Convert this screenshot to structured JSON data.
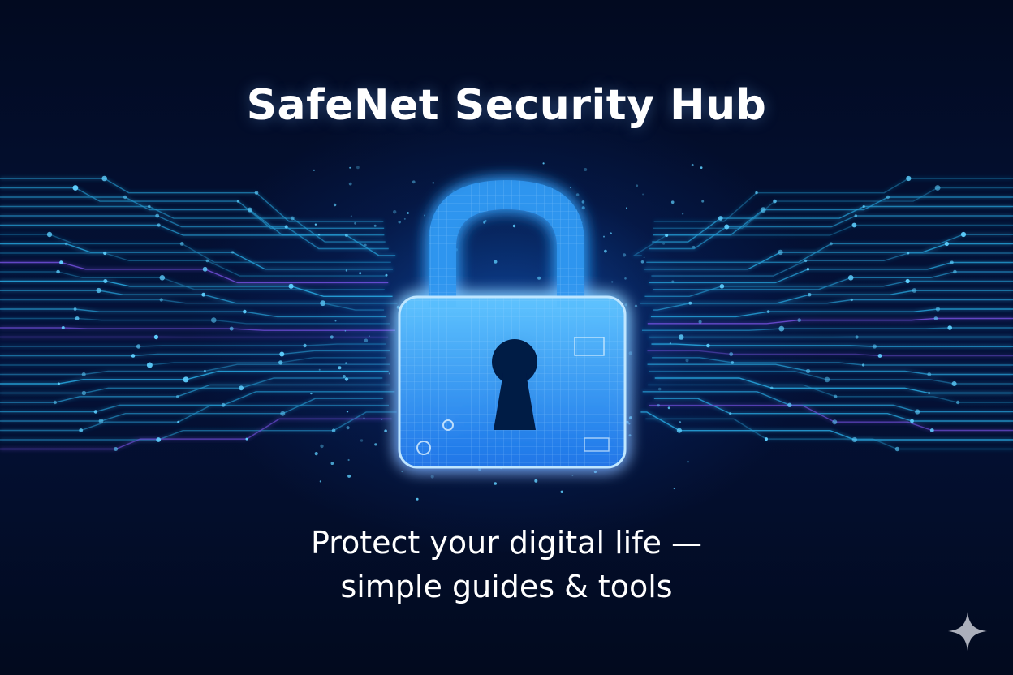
{
  "hero": {
    "title": "SafeNet Security Hub",
    "tagline_line1": "Protect your digital life —",
    "tagline_line2": "simple guides & tools"
  },
  "icons": {
    "lock": "padlock-icon",
    "corner": "sparkle-icon"
  },
  "colors": {
    "background": "#030b22",
    "glow": "#1e7bff",
    "circuit": "#2bb6f0",
    "accent": "#8a5cff",
    "text": "#ffffff"
  }
}
